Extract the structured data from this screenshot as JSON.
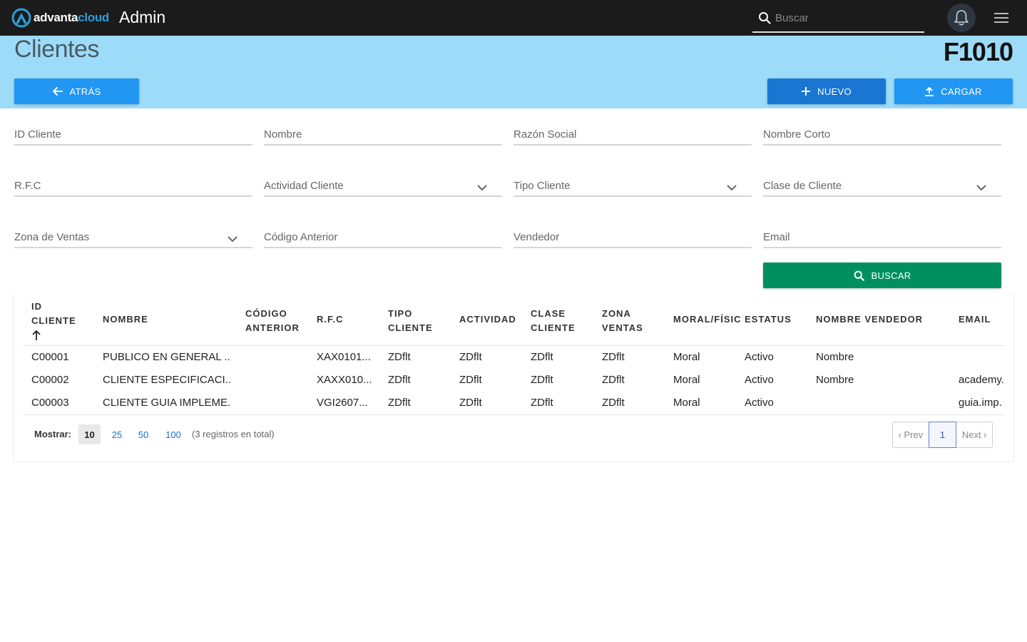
{
  "topbar": {
    "logo_part1": "advanta",
    "logo_part2": "cloud",
    "app_title": "Admin",
    "search_placeholder": "Buscar",
    "icons": {
      "search": "search-icon",
      "bell": "bell-icon",
      "menu": "hamburger-icon"
    }
  },
  "header": {
    "title": "Clientes",
    "code": "F1010",
    "back_label": "ATRÁS",
    "new_label": "NUEVO",
    "load_label": "CARGAR"
  },
  "filters": {
    "id_cliente": "ID Cliente",
    "nombre": "Nombre",
    "razon_social": "Razón Social",
    "nombre_corto": "Nombre Corto",
    "rfc": "R.F.C",
    "actividad_cliente": "Actividad Cliente",
    "tipo_cliente": "Tipo Cliente",
    "clase_cliente": "Clase de Cliente",
    "zona_ventas": "Zona de Ventas",
    "codigo_anterior": "Código Anterior",
    "vendedor": "Vendedor",
    "email": "Email",
    "search_label": "BUSCAR"
  },
  "table": {
    "headers": {
      "id_1": "ID",
      "id_2": "CLIENTE",
      "nombre": "NOMBRE",
      "codigo_1": "CÓDIGO",
      "codigo_2": "ANTERIOR",
      "rfc": "R.F.C",
      "tipo_1": "TIPO",
      "tipo_2": "CLIENTE",
      "actividad": "ACTIVIDAD",
      "clase_1": "CLASE",
      "clase_2": "CLIENTE",
      "zona_1": "ZONA",
      "zona_2": "VENTAS",
      "moral": "MORAL/FÍSIC",
      "estatus": "ESTATUS",
      "vendedor": "NOMBRE VENDEDOR",
      "email": "EMAIL"
    },
    "rows": [
      {
        "id": "C00001",
        "nombre": "PUBLICO EN GENERAL ...",
        "codigo": "",
        "rfc": "XAX0101...",
        "tipo": "ZDflt",
        "actividad": "ZDflt",
        "clase": "ZDflt",
        "zona": "ZDflt",
        "moral": "Moral",
        "estatus": "Activo",
        "vendedor": "Nombre",
        "email": ""
      },
      {
        "id": "C00002",
        "nombre": "CLIENTE ESPECIFICACI...",
        "codigo": "",
        "rfc": "XAXX010...",
        "tipo": "ZDflt",
        "actividad": "ZDflt",
        "clase": "ZDflt",
        "zona": "ZDflt",
        "moral": "Moral",
        "estatus": "Activo",
        "vendedor": "Nombre",
        "email": "academy."
      },
      {
        "id": "C00003",
        "nombre": "CLIENTE GUIA IMPLEME...",
        "codigo": "",
        "rfc": "VGI2607...",
        "tipo": "ZDflt",
        "actividad": "ZDflt",
        "clase": "ZDflt",
        "zona": "ZDflt",
        "moral": "Moral",
        "estatus": "Activo",
        "vendedor": "",
        "email": "guia.imp."
      }
    ]
  },
  "footer": {
    "mostrar": "Mostrar:",
    "sizes": [
      "10",
      "25",
      "50",
      "100"
    ],
    "selected_size": "10",
    "total": "(3 registros en total)",
    "prev": "‹ Prev",
    "current_page": "1",
    "next": "Next ›"
  },
  "colors": {
    "topbar": "#1b1b1b",
    "band": "#9cdcf8",
    "primary": "#2196f3",
    "primary_dark": "#1976d2",
    "search_button": "#009060",
    "brand_accent": "#2a9fd8"
  }
}
